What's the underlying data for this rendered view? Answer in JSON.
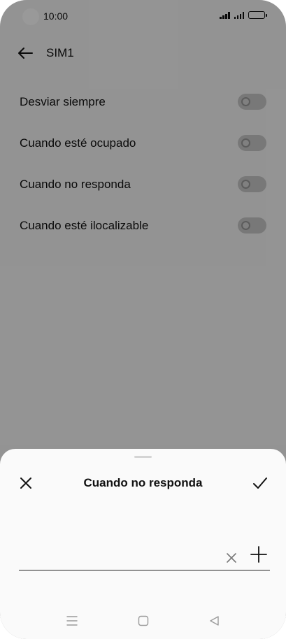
{
  "status_bar": {
    "time": "10:00",
    "icons": [
      "signal-icon",
      "signal-icon",
      "battery-icon"
    ]
  },
  "app_bar": {
    "title": "SIM1",
    "back_icon": "arrow-left-icon"
  },
  "forwarding_options": [
    {
      "label": "Desviar siempre",
      "enabled": false
    },
    {
      "label": "Cuando esté ocupado",
      "enabled": false
    },
    {
      "label": "Cuando no responda",
      "enabled": false
    },
    {
      "label": "Cuando esté ilocalizable",
      "enabled": false
    }
  ],
  "sheet": {
    "title": "Cuando no responda",
    "close_icon": "close-icon",
    "confirm_icon": "check-icon",
    "number_input": {
      "value": "",
      "placeholder": ""
    },
    "clear_icon": "clear-icon",
    "contacts_icon": "plus-icon"
  },
  "nav_bar": {
    "icons": [
      "menu-icon",
      "home-icon",
      "back-triangle-icon"
    ]
  },
  "colors": {
    "scrim": "#000000",
    "sheet_background": "#fafafa",
    "text": "#111111"
  }
}
